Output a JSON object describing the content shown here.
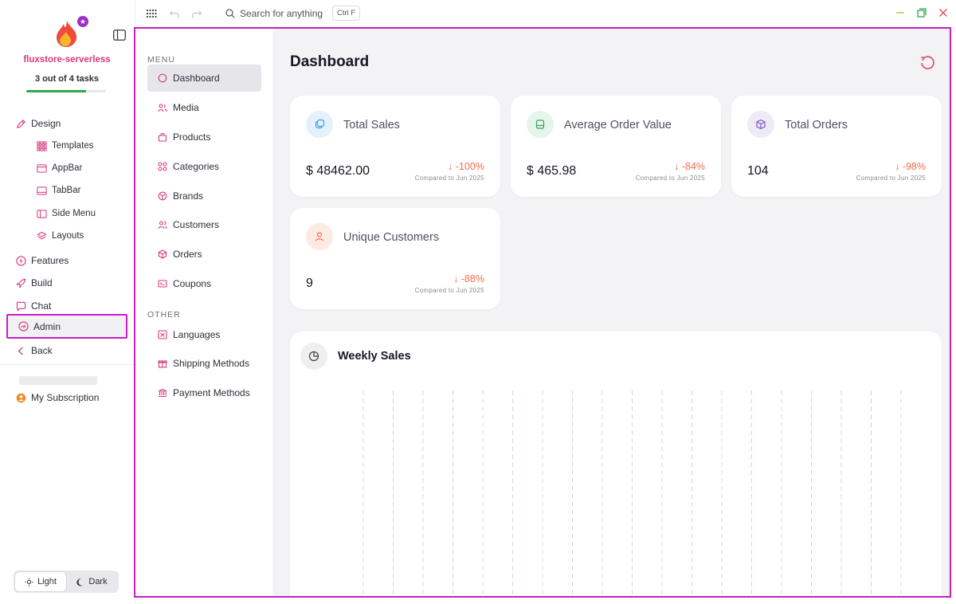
{
  "sidebar": {
    "project_name": "fluxstore-serverless",
    "tasks": {
      "label": "3 out of 4 tasks",
      "done": 3,
      "total": 4
    },
    "nav": {
      "design": "Design",
      "templates": "Templates",
      "appbar": "AppBar",
      "tabbar": "TabBar",
      "side_menu": "Side Menu",
      "layouts": "Layouts",
      "features": "Features",
      "build": "Build",
      "chat": "Chat",
      "admin": "Admin",
      "back": "Back"
    },
    "subscription": "My Subscription",
    "theme": {
      "light": "Light",
      "dark": "Dark",
      "selected": "Light"
    }
  },
  "topbar": {
    "search_placeholder": "Search for anything",
    "shortcut": "Ctrl F"
  },
  "admin_menu": {
    "menu_heading": "MENU",
    "items": [
      "Dashboard",
      "Media",
      "Products",
      "Categories",
      "Brands",
      "Customers",
      "Orders",
      "Coupons"
    ],
    "other_heading": "OTHER",
    "other_items": [
      "Languages",
      "Shipping Methods",
      "Payment Methods"
    ],
    "active": "Dashboard"
  },
  "dashboard": {
    "title": "Dashboard",
    "stats": [
      {
        "title": "Total Sales",
        "value": "$ 48462.00",
        "delta": "-100%",
        "compare": "Compared to Jun 2025",
        "icon": "coins-icon",
        "icon_bg": "#e3f1fb",
        "icon_color": "#3a9fd8"
      },
      {
        "title": "Average Order Value",
        "value": "$ 465.98",
        "delta": "-84%",
        "compare": "Compared to Jun 2025",
        "icon": "wallet-icon",
        "icon_bg": "#e5f5ea",
        "icon_color": "#3aa05c"
      },
      {
        "title": "Total Orders",
        "value": "104",
        "delta": "-98%",
        "compare": "Compared to Jun 2025",
        "icon": "box-icon",
        "icon_bg": "#efeaf8",
        "icon_color": "#7b55c9"
      },
      {
        "title": "Unique Customers",
        "value": "9",
        "delta": "-88%",
        "compare": "Compared to Jun 2025",
        "icon": "user-icon",
        "icon_bg": "#fdebe2",
        "icon_color": "#ef6f4d"
      }
    ],
    "weekly_sales": {
      "title": "Weekly Sales"
    }
  },
  "colors": {
    "accent_pink": "#d63a7e",
    "highlight_border": "#c61fc2",
    "negative_delta": "#ef6f4d",
    "progress": "#2fa84f"
  }
}
